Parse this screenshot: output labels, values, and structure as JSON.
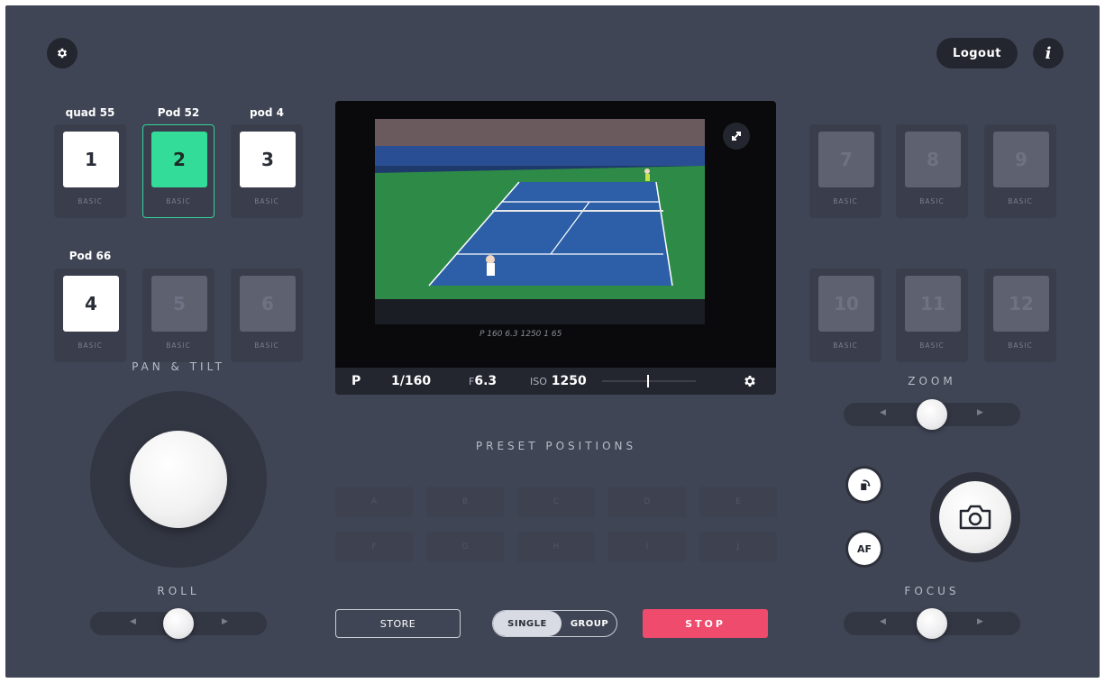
{
  "header": {
    "logout_label": "Logout",
    "info_label": "i"
  },
  "cameras": [
    {
      "label": "quad 55",
      "number": "1",
      "mode": "BASIC",
      "state": "on"
    },
    {
      "label": "Pod 52",
      "number": "2",
      "mode": "BASIC",
      "state": "active"
    },
    {
      "label": "pod 4",
      "number": "3",
      "mode": "BASIC",
      "state": "on"
    },
    {
      "label": "Pod 66",
      "number": "4",
      "mode": "BASIC",
      "state": "on"
    },
    {
      "label": "",
      "number": "5",
      "mode": "BASIC",
      "state": "off"
    },
    {
      "label": "",
      "number": "6",
      "mode": "BASIC",
      "state": "off"
    },
    {
      "label": "",
      "number": "7",
      "mode": "BASIC",
      "state": "off"
    },
    {
      "label": "",
      "number": "8",
      "mode": "BASIC",
      "state": "off"
    },
    {
      "label": "",
      "number": "9",
      "mode": "BASIC",
      "state": "off"
    },
    {
      "label": "",
      "number": "10",
      "mode": "BASIC",
      "state": "off"
    },
    {
      "label": "",
      "number": "11",
      "mode": "BASIC",
      "state": "off"
    },
    {
      "label": "",
      "number": "12",
      "mode": "BASIC",
      "state": "off"
    }
  ],
  "video": {
    "overlay_readout": "P 160 6.3 1250 1 65",
    "mode": "P",
    "shutter": "1/160",
    "aperture_prefix": "F",
    "aperture": "6.3",
    "iso_prefix": "ISO",
    "iso": "1250"
  },
  "labels": {
    "pan_tilt": "PAN & TILT",
    "roll": "ROLL",
    "zoom": "ZOOM",
    "focus": "FOCUS",
    "preset_positions": "PRESET POSITIONS",
    "af": "AF"
  },
  "presets": [
    "A",
    "B",
    "C",
    "D",
    "E",
    "F",
    "G",
    "H",
    "I",
    "J"
  ],
  "buttons": {
    "store": "STORE",
    "single": "SINGLE",
    "group": "GROUP",
    "stop": "STOP"
  },
  "sliders": {
    "roll": 0.5,
    "zoom": 0.5,
    "focus": 0.5
  },
  "colors": {
    "background": "#404555",
    "active_camera": "#33dd99",
    "stop": "#ee4b6d"
  }
}
